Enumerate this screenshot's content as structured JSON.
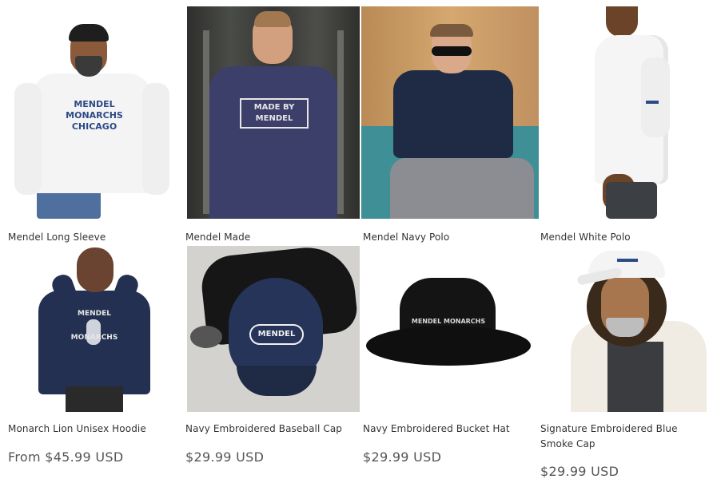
{
  "products": [
    {
      "name": "Mendel Long Sleeve",
      "price": "",
      "shirt_print": "MENDEL\nMONARCHS\nCHICAGO"
    },
    {
      "name": "Mendel Made",
      "price": "",
      "shirt_print": "MADE BY\nMENDEL"
    },
    {
      "name": "Mendel Navy Polo",
      "price": ""
    },
    {
      "name": "Mendel White Polo",
      "price": ""
    },
    {
      "name": "Monarch Lion Unisex Hoodie",
      "price": "From $45.99 USD",
      "shirt_print": "MENDEL\nMONARCHS"
    },
    {
      "name": "Navy Embroidered Baseball Cap",
      "price": "$29.99 USD",
      "shirt_print": "MENDEL"
    },
    {
      "name": "Navy Embroidered Bucket Hat",
      "price": "$29.99 USD",
      "shirt_print": "MENDEL MONARCHS"
    },
    {
      "name": "Signature Embroidered Blue Smoke Cap",
      "price": "$29.99 USD"
    }
  ],
  "colors": {
    "navy": "#1f2a44",
    "text": "#333333",
    "price": "#555555"
  }
}
